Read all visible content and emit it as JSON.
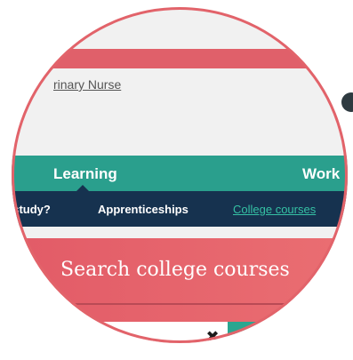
{
  "page": {
    "profile_link": "rinary Nurse"
  },
  "nav": {
    "primary": {
      "learning_label": "Learning",
      "work_label": "Work"
    },
    "secondary": {
      "study_label": "l study?",
      "apprenticeships_label": "Apprenticeships",
      "college_courses_label": "College courses"
    }
  },
  "search": {
    "title": "Search college courses",
    "query_value": "",
    "clear_icon": "close-icon",
    "go_icon": "target-icon"
  },
  "colors": {
    "brand_red": "#e0606a",
    "teal": "#2a9f8d",
    "navy": "#16324f",
    "link_teal": "#35c1a4"
  }
}
